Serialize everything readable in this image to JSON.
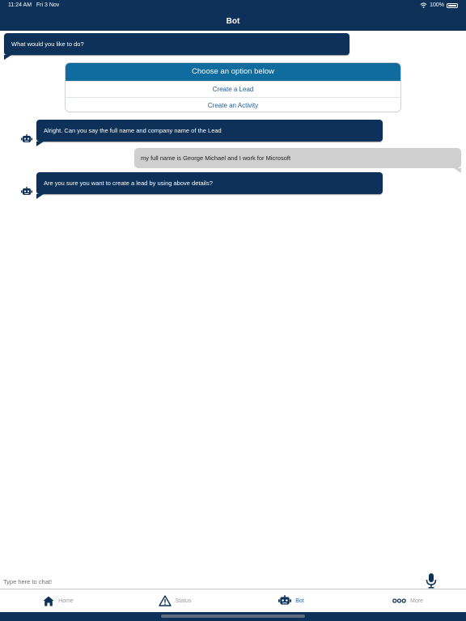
{
  "status_bar": {
    "time": "11:24 AM",
    "date": "Fri 3 Nov",
    "battery": "100%"
  },
  "header": {
    "title": "Bot"
  },
  "messages": [
    {
      "sender": "bot",
      "text": "What would you like to do?"
    },
    {
      "sender": "bot",
      "text": "Alright. Can you say the full name and company name of the Lead"
    },
    {
      "sender": "user",
      "text": "my full name is George Michael and I work for Microsoft"
    },
    {
      "sender": "bot",
      "text": "Are you sure you want to create a lead by using above details?"
    }
  ],
  "options_card": {
    "title": "Choose an option below",
    "options": [
      "Create a Lead",
      "Create an Activity"
    ]
  },
  "chat_input": {
    "placeholder": "Type here to chat!",
    "value": ""
  },
  "tabs": [
    {
      "label": "Home",
      "icon": "home-icon",
      "active": false
    },
    {
      "label": "Status",
      "icon": "warning-icon",
      "active": false
    },
    {
      "label": "Bot",
      "icon": "robot-icon",
      "active": true
    },
    {
      "label": "More",
      "icon": "more-icon",
      "active": false
    }
  ],
  "colors": {
    "navy": "#0d3158",
    "card_header": "#106b9e",
    "active_tab": "#2a6ab1",
    "user_bubble": "#cfcfcf"
  }
}
